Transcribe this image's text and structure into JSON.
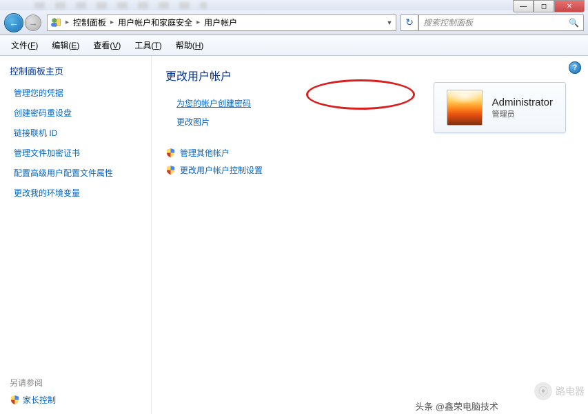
{
  "window_controls": {
    "min_label": "—",
    "max_label": "◻",
    "close_label": "✕"
  },
  "breadcrumb": {
    "items": [
      {
        "label": "控制面板"
      },
      {
        "label": "用户帐户和家庭安全"
      },
      {
        "label": "用户帐户"
      }
    ]
  },
  "search": {
    "placeholder": "搜索控制面板"
  },
  "menu": {
    "file": {
      "label": "文件(",
      "key": "F",
      "suffix": ")"
    },
    "edit": {
      "label": "编辑(",
      "key": "E",
      "suffix": ")"
    },
    "view": {
      "label": "查看(",
      "key": "V",
      "suffix": ")"
    },
    "tools": {
      "label": "工具(",
      "key": "T",
      "suffix": ")"
    },
    "help": {
      "label": "帮助(",
      "key": "H",
      "suffix": ")"
    }
  },
  "sidebar": {
    "title": "控制面板主页",
    "links": [
      "管理您的凭据",
      "创建密码重设盘",
      "链接联机 ID",
      "管理文件加密证书",
      "配置高级用户配置文件属性",
      "更改我的环境变量"
    ],
    "also_see": "另请参阅",
    "parental": "家长控制"
  },
  "main": {
    "title": "更改用户帐户",
    "links": {
      "create_password": "为您的帐户创建密码",
      "change_picture": "更改图片",
      "manage_other": "管理其他帐户",
      "change_uac": "更改用户帐户控制设置"
    }
  },
  "account": {
    "name": "Administrator",
    "role": "管理员"
  },
  "footer": {
    "attribution": "头条 @鑫荣电脑技术",
    "watermark": "路电器"
  }
}
